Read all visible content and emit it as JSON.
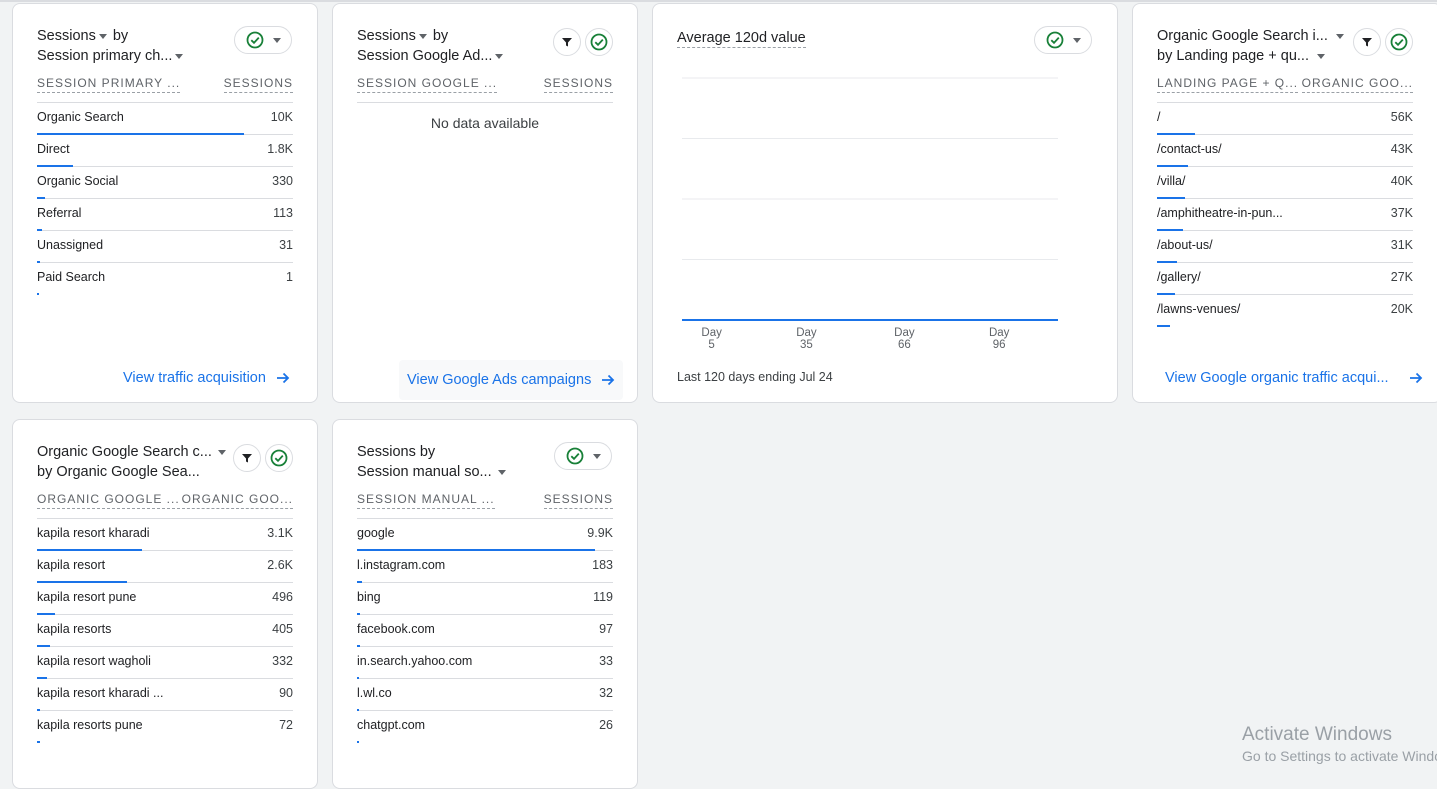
{
  "cards": {
    "c1": {
      "title1": "Sessions",
      "title1_suffix": " by",
      "title2": "Session primary ch...",
      "col1": "SESSION PRIMARY ...",
      "col2": "SESSIONS",
      "rows": [
        {
          "label": "Organic Search",
          "value": "10K",
          "bar_pct": 81
        },
        {
          "label": "Direct",
          "value": "1.8K",
          "bar_pct": 14
        },
        {
          "label": "Organic Social",
          "value": "330",
          "bar_pct": 3
        },
        {
          "label": "Referral",
          "value": "113",
          "bar_pct": 2
        },
        {
          "label": "Unassigned",
          "value": "31",
          "bar_pct": 1
        },
        {
          "label": "Paid Search",
          "value": "1",
          "bar_pct": 0
        }
      ],
      "link": "View traffic acquisition"
    },
    "c2": {
      "title1": "Sessions",
      "title1_suffix": " by",
      "title2": "Session Google Ad...",
      "col1": "SESSION GOOGLE ...",
      "col2": "SESSIONS",
      "nodata": "No data available",
      "link": "View Google Ads campaigns"
    },
    "c3": {
      "title": "Average 120d value",
      "caption": "Last 120 days ending Jul 24"
    },
    "c4": {
      "title1": "Organic Google Search i...",
      "title2": "by Landing page + qu...",
      "col1": "LANDING PAGE + Q...",
      "col2": "ORGANIC GOO...",
      "rows": [
        {
          "label": "/",
          "value": "56K",
          "bar_pct": 15
        },
        {
          "label": "/contact-us/",
          "value": "43K",
          "bar_pct": 12
        },
        {
          "label": "/villa/",
          "value": "40K",
          "bar_pct": 11
        },
        {
          "label": "/amphitheatre-in-pun...",
          "value": "37K",
          "bar_pct": 10
        },
        {
          "label": "/about-us/",
          "value": "31K",
          "bar_pct": 8
        },
        {
          "label": "/gallery/",
          "value": "27K",
          "bar_pct": 7
        },
        {
          "label": "/lawns-venues/",
          "value": "20K",
          "bar_pct": 5
        }
      ],
      "link": "View Google organic traffic acqui..."
    },
    "c5": {
      "title1": "Organic Google Search c...",
      "title2": "by Organic Google Sea...",
      "col1": "ORGANIC GOOGLE ...",
      "col2": "ORGANIC GOO...",
      "rows": [
        {
          "label": "kapila resort kharadi",
          "value": "3.1K",
          "bar_pct": 41
        },
        {
          "label": "kapila resort",
          "value": "2.6K",
          "bar_pct": 35
        },
        {
          "label": "kapila resort pune",
          "value": "496",
          "bar_pct": 7
        },
        {
          "label": "kapila resorts",
          "value": "405",
          "bar_pct": 5
        },
        {
          "label": "kapila resort wagholi",
          "value": "332",
          "bar_pct": 4
        },
        {
          "label": "kapila resort kharadi ...",
          "value": "90",
          "bar_pct": 1
        },
        {
          "label": "kapila resorts pune",
          "value": "72",
          "bar_pct": 1
        }
      ]
    },
    "c6": {
      "title1": "Sessions",
      "title1_suffix": " by",
      "title2": "Session manual so...",
      "col1": "SESSION MANUAL ...",
      "col2": "SESSIONS",
      "rows": [
        {
          "label": "google",
          "value": "9.9K",
          "bar_pct": 93
        },
        {
          "label": "l.instagram.com",
          "value": "183",
          "bar_pct": 2
        },
        {
          "label": "bing",
          "value": "119",
          "bar_pct": 1
        },
        {
          "label": "facebook.com",
          "value": "97",
          "bar_pct": 1
        },
        {
          "label": "in.search.yahoo.com",
          "value": "33",
          "bar_pct": 0
        },
        {
          "label": "l.wl.co",
          "value": "32",
          "bar_pct": 0
        },
        {
          "label": "chatgpt.com",
          "value": "26",
          "bar_pct": 0
        }
      ]
    }
  },
  "chart_data": {
    "type": "line",
    "title": "Average 120d value",
    "x_ticks": [
      {
        "top": "Day",
        "bottom": "5"
      },
      {
        "top": "Day",
        "bottom": "35"
      },
      {
        "top": "Day",
        "bottom": "66"
      },
      {
        "top": "Day",
        "bottom": "96"
      }
    ],
    "x_range": [
      1,
      120
    ],
    "series": [
      {
        "values": [
          0,
          0
        ]
      }
    ],
    "grid": true,
    "colors": {
      "line": "#1a73e8",
      "grid": "#e8eaed"
    }
  },
  "watermark": {
    "line1": "Activate Windows",
    "line2": "Go to Settings to activate Windows."
  },
  "colors": {
    "accent": "#1a73e8",
    "check": "#188038"
  }
}
